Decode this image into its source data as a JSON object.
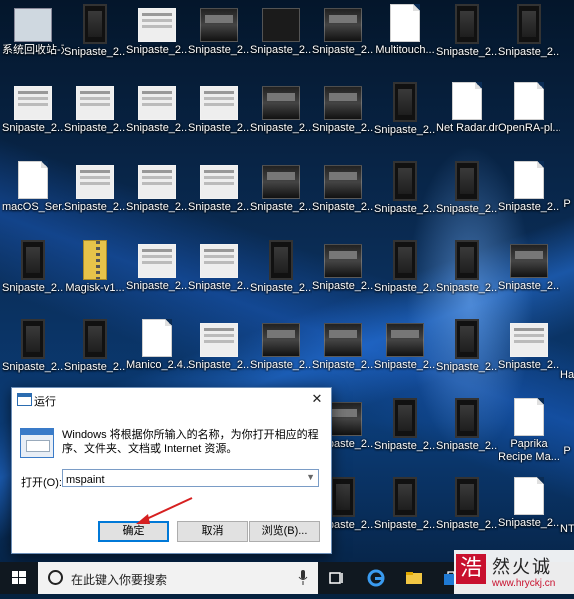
{
  "desktop": {
    "icons": [
      {
        "label": "系统回收站-双击打开回收站",
        "style": "recycle"
      },
      {
        "label": "Snipaste_2...",
        "style": "phone"
      },
      {
        "label": "Snipaste_2...",
        "style": "window"
      },
      {
        "label": "Snipaste_2...",
        "style": "screen"
      },
      {
        "label": "Snipaste_2...",
        "style": "dark"
      },
      {
        "label": "Snipaste_2...",
        "style": "screen"
      },
      {
        "label": "Multitouch...",
        "style": "doc"
      },
      {
        "label": "Snipaste_2...",
        "style": "phone"
      },
      {
        "label": "Snipaste_2...",
        "style": "phone"
      },
      {
        "label": "Snipaste_2...",
        "style": "window"
      },
      {
        "label": "Snipaste_2...",
        "style": "window"
      },
      {
        "label": "Snipaste_2...",
        "style": "window"
      },
      {
        "label": "Snipaste_2...",
        "style": "window"
      },
      {
        "label": "Snipaste_2...",
        "style": "screen"
      },
      {
        "label": "Snipaste_2...",
        "style": "screen"
      },
      {
        "label": "Snipaste_2...",
        "style": "phone"
      },
      {
        "label": "Net Radar.dmg",
        "style": "doc"
      },
      {
        "label": "OpenRA-pl...",
        "style": "doc"
      },
      {
        "label": "macOS_Ser...",
        "style": "doc"
      },
      {
        "label": "Snipaste_2...",
        "style": "window"
      },
      {
        "label": "Snipaste_2...",
        "style": "window"
      },
      {
        "label": "Snipaste_2...",
        "style": "window"
      },
      {
        "label": "Snipaste_2...",
        "style": "screen"
      },
      {
        "label": "Snipaste_2...",
        "style": "screen"
      },
      {
        "label": "Snipaste_2...",
        "style": "phone"
      },
      {
        "label": "Snipaste_2...",
        "style": "phone"
      },
      {
        "label": "Snipaste_2...",
        "style": "doc"
      },
      {
        "label": "Snipaste_2...",
        "style": "phone"
      },
      {
        "label": "Magisk-v1...",
        "style": "zip"
      },
      {
        "label": "Snipaste_2...",
        "style": "window"
      },
      {
        "label": "Snipaste_2...",
        "style": "window"
      },
      {
        "label": "Snipaste_2...",
        "style": "phone"
      },
      {
        "label": "Snipaste_2...",
        "style": "screen"
      },
      {
        "label": "Snipaste_2...",
        "style": "phone"
      },
      {
        "label": "Snipaste_2...",
        "style": "phone"
      },
      {
        "label": "Snipaste_2...",
        "style": "screen"
      },
      {
        "label": "Snipaste_2...",
        "style": "phone"
      },
      {
        "label": "Snipaste_2...",
        "style": "phone"
      },
      {
        "label": "Manico_2.4....",
        "style": "doc"
      },
      {
        "label": "Snipaste_2...",
        "style": "window"
      },
      {
        "label": "Snipaste_2...",
        "style": "screen"
      },
      {
        "label": "Snipaste_2...",
        "style": "screen"
      },
      {
        "label": "Snipaste_2...",
        "style": "screen"
      },
      {
        "label": "Snipaste_2...",
        "style": "phone"
      },
      {
        "label": "Snipaste_2...",
        "style": "window"
      },
      {
        "label": "Snipaste_2...",
        "style": "screen"
      },
      {
        "label": "Snipaste_2...",
        "style": "phone"
      },
      {
        "label": "Snipaste_2...",
        "style": "phone"
      },
      {
        "label": "Paprika Recipe Ma...",
        "style": "doc"
      },
      {
        "label": "Snipaste_2...",
        "style": "phone"
      },
      {
        "label": "Snipaste_2...",
        "style": "phone"
      },
      {
        "label": "Snipaste_2...",
        "style": "phone"
      },
      {
        "label": "Snipaste_2...",
        "style": "doc"
      }
    ],
    "edge_labels": [
      "P",
      "Ha",
      "P",
      "NT"
    ]
  },
  "run_dialog": {
    "title": "运行",
    "description": "Windows 将根据你所输入的名称，为你打开相应的程序、文件夹、文档或 Internet 资源。",
    "open_label": "打开(O):",
    "input_value": "mspaint",
    "ok_label": "确定",
    "cancel_label": "取消",
    "browse_label": "浏览(B)...",
    "close_glyph": "✕"
  },
  "taskbar": {
    "search_placeholder": "在此键入你要搜索"
  },
  "watermark": {
    "logo_char": "浩",
    "name": "然火诚",
    "url": "www.hryckj.cn"
  }
}
